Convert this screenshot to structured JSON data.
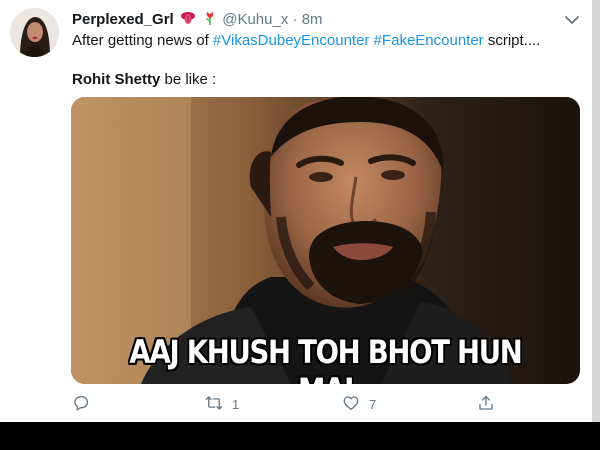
{
  "tweet": {
    "display_name": "Perplexed_Grl",
    "handle": "@Kuhu_x",
    "separator": "·",
    "time": "8m",
    "line1_prefix": "After getting news of ",
    "hashtag1": "#VikasDubeyEncounter",
    "hashtag2": "#FakeEncounter",
    "line1_suffix": " script....",
    "line2_bold": "Rohit Shetty",
    "line2_rest": " be like :",
    "media_caption": "AAJ KHUSH TOH BHOT HUN MAI"
  },
  "actions": {
    "reply_count": "",
    "retweet_count": "1",
    "like_count": "7"
  },
  "colors": {
    "link": "#1b95e0",
    "muted": "#657786",
    "text": "#14171a"
  },
  "icons": [
    "tongue-emoji-icon",
    "flower-emoji-icon",
    "chevron-down-icon",
    "reply-icon",
    "retweet-icon",
    "like-icon",
    "share-icon"
  ]
}
